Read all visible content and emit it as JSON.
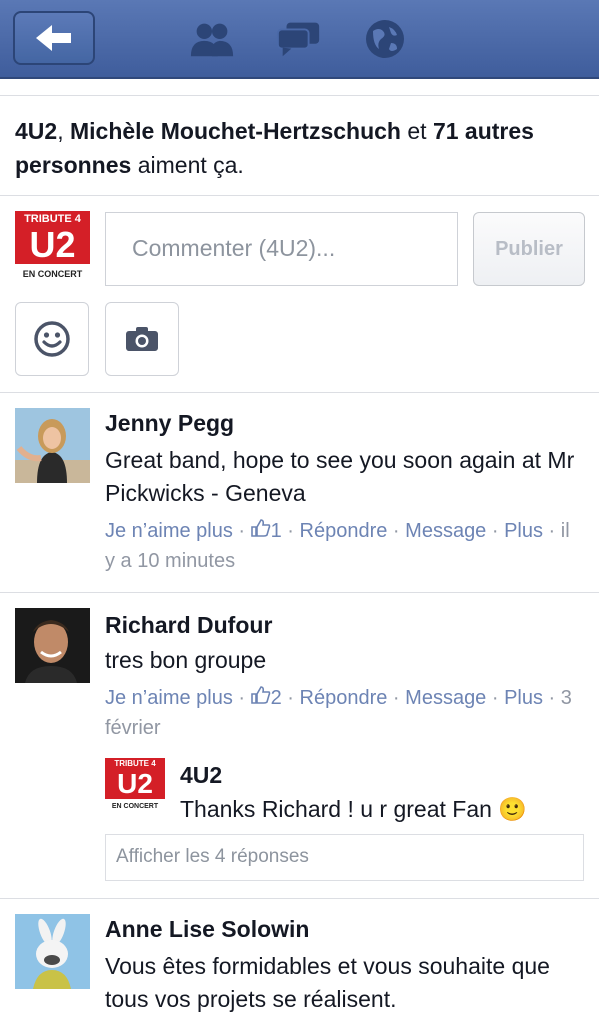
{
  "likes": {
    "name1": "4U2",
    "sep1": ", ",
    "name2": "Michèle Mouchet-Hertzschuch",
    "sep2": " et ",
    "others": "71 autres personnes",
    "suffix": " aiment ça."
  },
  "logo": {
    "line1": "TRIBUTE 4",
    "line2": "U2",
    "line3": "EN CONCERT"
  },
  "composer": {
    "placeholder": "Commenter (4U2)...",
    "publish_label": "Publier"
  },
  "comments": [
    {
      "author": "Jenny Pegg",
      "text": "Great band, hope to see you soon again at Mr Pickwicks - Geneva",
      "unlike": "Je n’aime plus",
      "like_count": "1",
      "reply": "Répondre",
      "message": "Message",
      "more": "Plus",
      "time": "il y a 10 minutes"
    },
    {
      "author": "Richard Dufour",
      "text": "tres bon groupe",
      "unlike": "Je n’aime plus",
      "like_count": "2",
      "reply": "Répondre",
      "message": "Message",
      "more": "Plus",
      "time": "3 février"
    },
    {
      "author": "Anne Lise Solowin",
      "text": "Vous êtes formidables et vous souhaite que tous vos projets se réalisent."
    }
  ],
  "reply": {
    "author": "4U2",
    "text": "Thanks Richard ! u r great Fan",
    "emoji": "🙂"
  },
  "show_replies": "Afficher les 4 réponses",
  "icons": [
    "back-arrow-icon",
    "friends-icon",
    "messages-icon",
    "globe-icon",
    "smiley-icon",
    "camera-icon",
    "thumbs-up-icon"
  ],
  "colors": {
    "header": "#4a69a8",
    "link": "#6d84b4",
    "logo_red": "#d41f27"
  }
}
